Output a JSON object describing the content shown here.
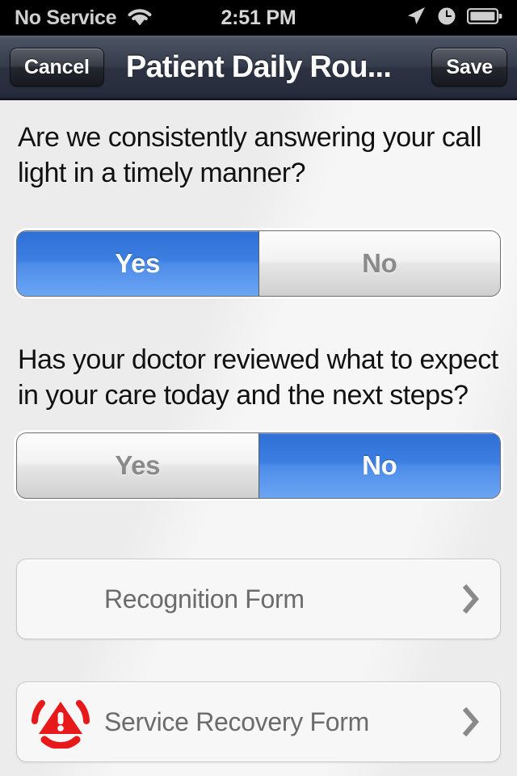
{
  "status_bar": {
    "carrier": "No Service",
    "time": "2:51 PM",
    "icons": [
      "wifi-icon",
      "location-arrow-icon",
      "alarm-clock-icon",
      "battery-icon"
    ]
  },
  "nav_bar": {
    "cancel_label": "Cancel",
    "title": "Patient Daily Rou...",
    "save_label": "Save"
  },
  "survey": {
    "questions": [
      {
        "text": "Are we consistently answering your call light in a timely manner?",
        "options": [
          "Yes",
          "No"
        ],
        "selected": "Yes"
      },
      {
        "text": "Has your doctor reviewed what to expect in your care today and the next steps?",
        "options": [
          "Yes",
          "No"
        ],
        "selected": "No"
      }
    ],
    "links": [
      {
        "label": "Recognition Form",
        "icon": "none",
        "accessory": "chevron-right-icon"
      },
      {
        "label": "Service Recovery Form",
        "icon": "red-alert-siren-icon",
        "accessory": "chevron-right-icon"
      }
    ]
  },
  "colors": {
    "accent_blue": "#3c7fe2",
    "alert_red": "#e8191a",
    "background": "#ececec",
    "nav_bar": "#2c3242"
  }
}
